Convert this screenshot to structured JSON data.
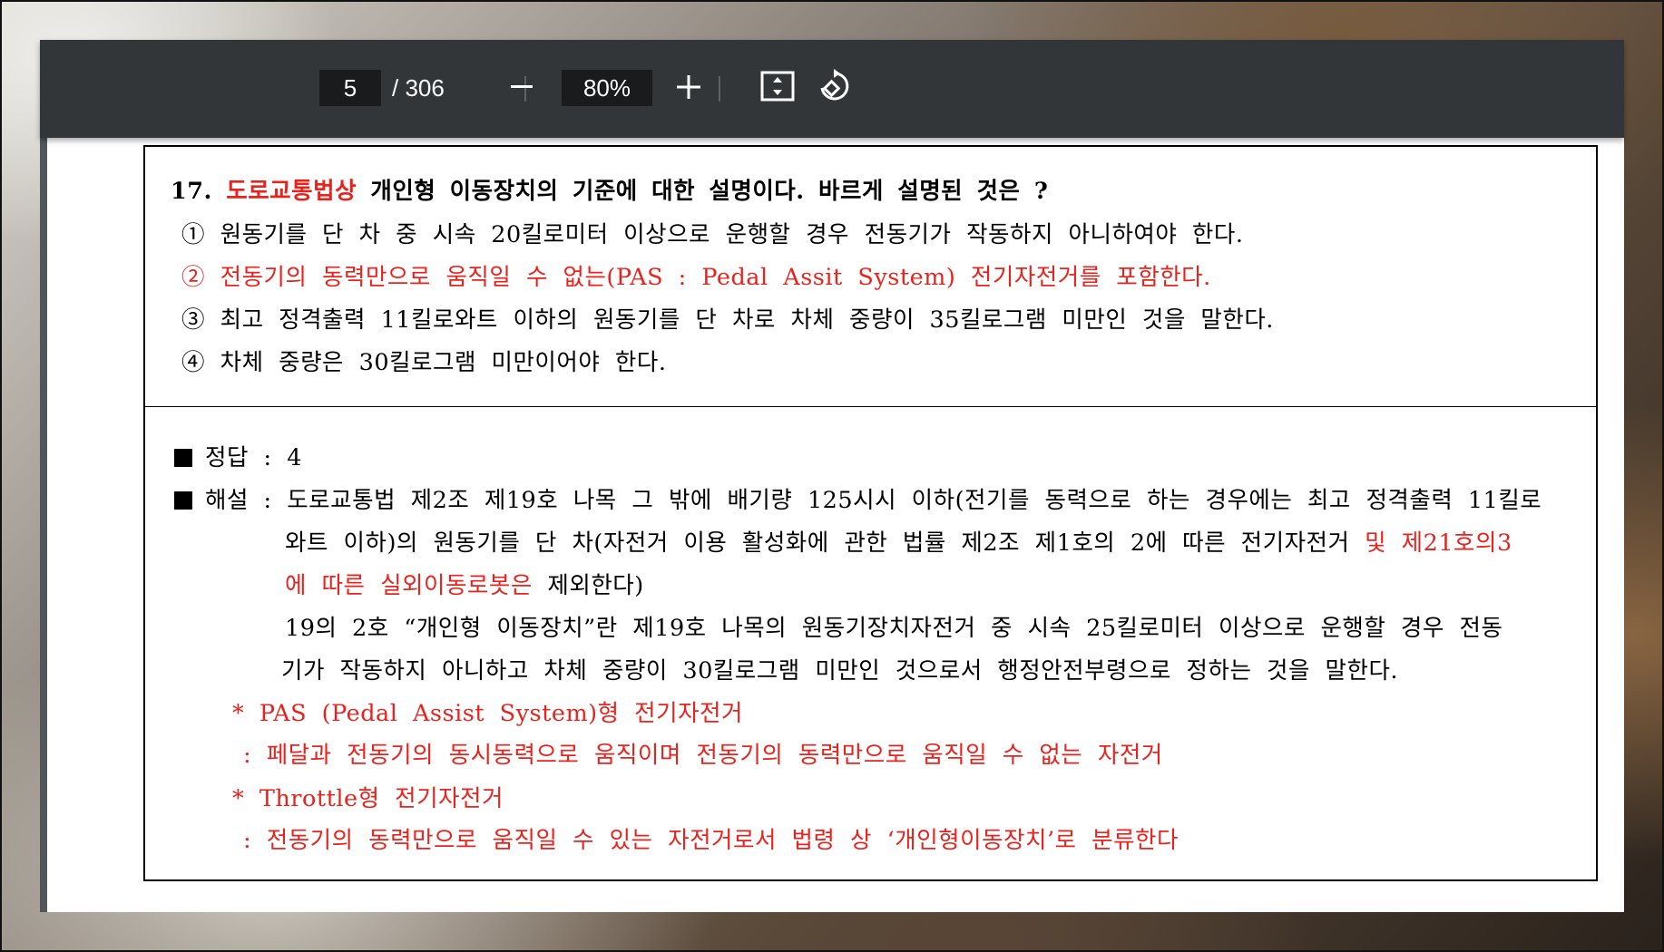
{
  "toolbar": {
    "current_page": "5",
    "total_pages": "/ 306",
    "zoom_out_label": "−",
    "zoom_level": "80%",
    "zoom_in_label": "+",
    "fit_icon": "fit-to-page-icon",
    "rotate_icon": "rotate-icon"
  },
  "question": {
    "number": "17.",
    "highlight": "도로교통법상",
    "title_rest": "개인형 이동장치의 기준에 대한 설명이다. 바르게 설명된 것은 ?",
    "options": [
      "① 원동기를 단 차 중 시속 20킬로미터 이상으로 운행할 경우 전동기가 작동하지 아니하여야 한다.",
      "② 전동기의 동력만으로 움직일 수 없는(PAS : Pedal Assit System) 전기자전거를 포함한다.",
      "③ 최고 정격출력 11킬로와트 이하의 원동기를 단 차로 차체 중량이 35킬로그램 미만인 것을 말한다.",
      "④ 차체 중량은 30킬로그램 미만이어야 한다."
    ]
  },
  "answer": {
    "label": "정답 : 4",
    "explanation_lines": [
      "해설 : 도로교통법 제2조 제19호 나목 그 밖에 배기량 125시시 이하(전기를 동력으로 하는 경우에는 최고 정격출력 11킬로",
      "와트 이하)의 원동기를 단 차(자전거 이용 활성화에 관한 법률 제2조 제1호의 2에 따른 전기자전거",
      "및 제21호의3",
      "에 따른 실외이동로봇은",
      "제외한다)",
      "19의 2호 “개인형 이동장치”란 제19호 나목의 원동기장치자전거 중 시속 25킬로미터 이상으로 운행할 경우 전동",
      "기가 작동하지 아니하고 차체 중량이 30킬로그램 미만인 것으로서 행정안전부령으로 정하는 것을 말한다."
    ],
    "notes": [
      "* PAS (Pedal Assist System)형 전기자전거",
      ": 페달과 전동기의 동시동력으로 움직이며 전동기의 동력만으로 움직일 수 없는 자전거",
      "* Throttle형 전기자전거",
      ": 전동기의 동력만으로 움직일 수 있는 자전거로서 법령 상 ‘개인형이동장치’로 분류한다"
    ]
  },
  "colors": {
    "highlight_red": "#e8231e",
    "toolbar_bg": "#323639"
  }
}
